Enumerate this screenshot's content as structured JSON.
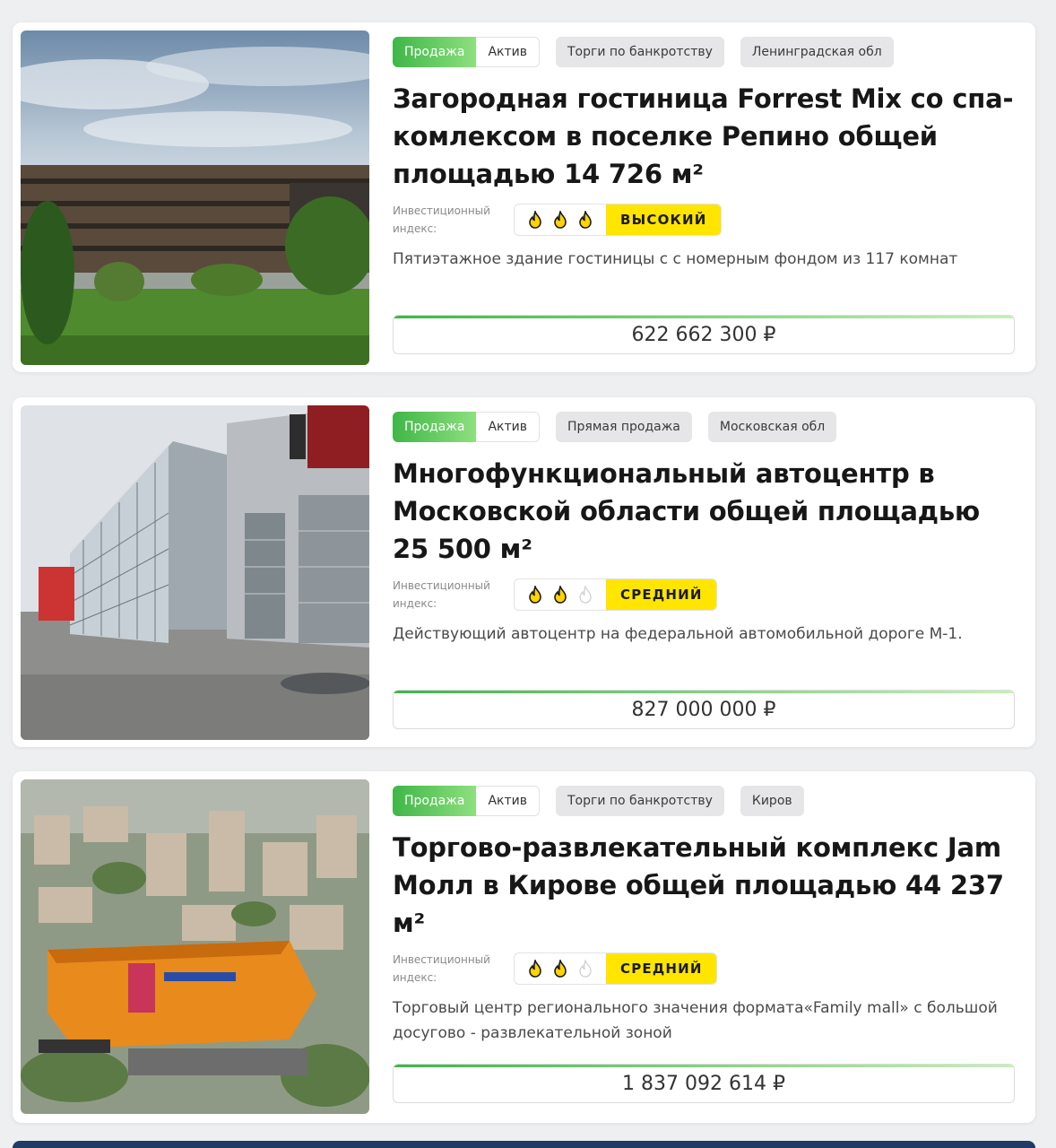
{
  "listings": [
    {
      "tags": {
        "deal": "Продажа",
        "type": "Актив",
        "method": "Торги по банкротству",
        "region": "Ленинградская обл"
      },
      "title": "Загородная гостиница Forrest Mix со спа-комлексом в поселке Репино общей площадью 14 726 м²",
      "investment_label": "Инвестиционный индекс:",
      "investment_flames": 3,
      "investment_level": "ВЫСОКИЙ",
      "description": "Пятиэтажное здание гостиницы с с номерным фондом из 117 комнат",
      "price": "622 662 300 ₽",
      "photo_icon": "hotel-photo"
    },
    {
      "tags": {
        "deal": "Продажа",
        "type": "Актив",
        "method": "Прямая продажа",
        "region": "Московская обл"
      },
      "title": "Многофункциональный автоцентр в Московской области общей площадью 25 500 м²",
      "investment_label": "Инвестиционный индекс:",
      "investment_flames": 2,
      "investment_level": "СРЕДНИЙ",
      "description": "Действующий автоцентр на федеральной автомобильной дороге М-1.",
      "price": "827 000 000 ₽",
      "photo_icon": "car-center-photo"
    },
    {
      "tags": {
        "deal": "Продажа",
        "type": "Актив",
        "method": "Торги по банкротству",
        "region": "Киров"
      },
      "title": "Торгово-развлекательный комплекс Jam Молл в Кирове общей площадью 44 237 м²",
      "investment_label": "Инвестиционный индекс:",
      "investment_flames": 2,
      "investment_level": "СРЕДНИЙ",
      "description": "Торговый центр регионального значения формата«Family mall» с большой досугово - развлекательной зоной",
      "price": "1 837 092 614 ₽",
      "photo_icon": "mall-aerial-photo"
    }
  ],
  "colors": {
    "sale_green": "#3fb648",
    "level_yellow": "#ffe500",
    "flame_active": "#ffd400",
    "flame_inactive": "#d0d0d0"
  }
}
